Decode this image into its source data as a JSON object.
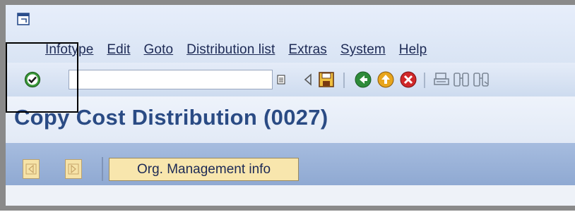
{
  "menubar": {
    "system_icon": "window-menu-icon",
    "items": [
      {
        "label": "Infotype"
      },
      {
        "label": "Edit"
      },
      {
        "label": "Goto"
      },
      {
        "label": "Distribution list"
      },
      {
        "label": "Extras"
      },
      {
        "label": "System"
      },
      {
        "label": "Help"
      }
    ]
  },
  "toolbar": {
    "enter_icon": "enter-checkmark-icon",
    "command_field": {
      "value": "",
      "placeholder": ""
    },
    "icons": [
      "command-history-dropdown-icon",
      "back-arrow-icon",
      "save-icon",
      "back-icon",
      "exit-icon",
      "cancel-icon",
      "print-icon",
      "find-icon",
      "find-next-icon"
    ]
  },
  "page": {
    "title": "Copy Cost Distribution (0027)"
  },
  "app_toolbar": {
    "org_button_label": "Org. Management info",
    "icons": [
      "previous-record-icon",
      "next-record-icon"
    ]
  },
  "colors": {
    "title_color": "#2a4b84",
    "button_fill": "#f8e6ad",
    "app_toolbar_bg": "#9bb3da"
  }
}
